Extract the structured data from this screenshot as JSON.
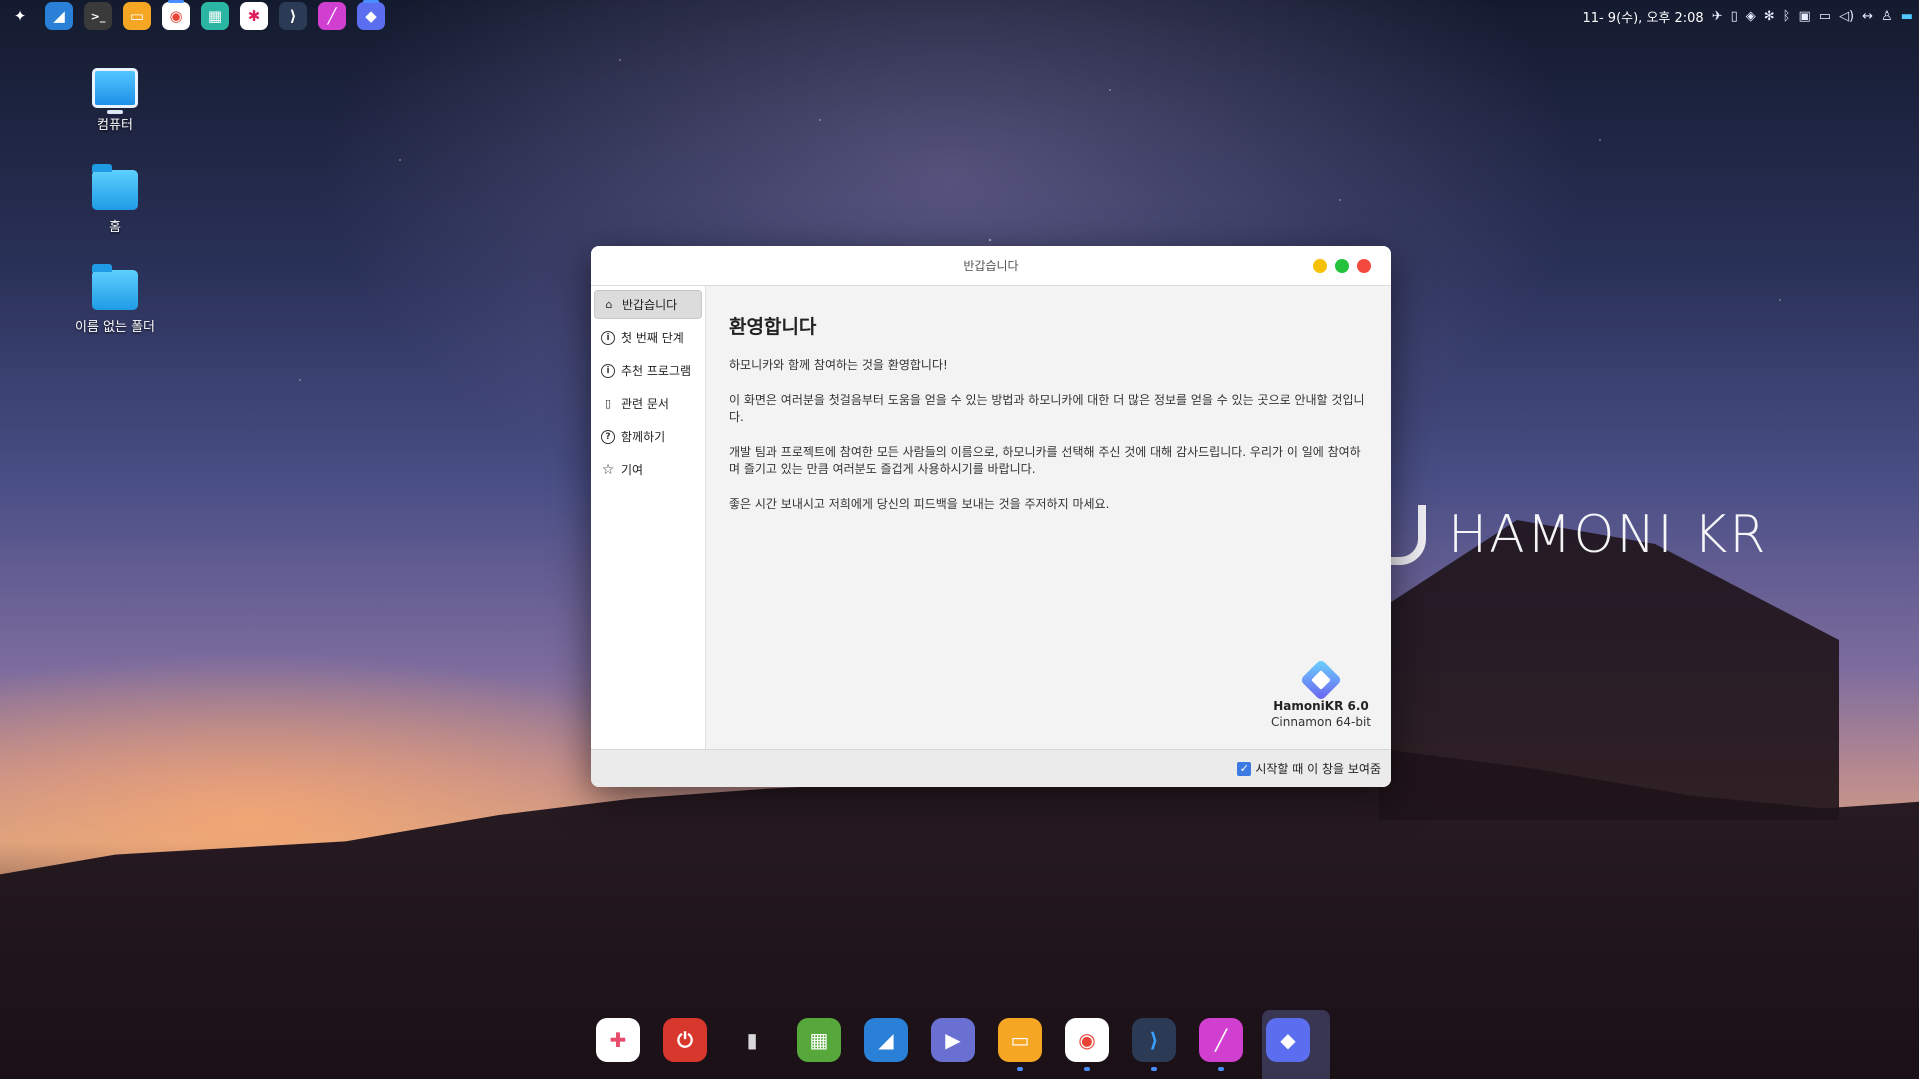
{
  "top_panel": {
    "apps": [
      {
        "icon": "hamonikr-menu-icon",
        "glyph": "✦",
        "color": "#4a6fd8"
      },
      {
        "icon": "bird-app-icon",
        "glyph": "◢",
        "color": "#2a7fd6"
      },
      {
        "icon": "terminal-icon",
        "glyph": ">_",
        "color": "#3a3a3a"
      },
      {
        "icon": "files-icon",
        "glyph": "▭",
        "color": "#f5a623"
      },
      {
        "icon": "chrome-icon",
        "glyph": "◉",
        "color": "#ea4335"
      },
      {
        "icon": "calculator-icon",
        "glyph": "▦",
        "color": "#2bb6a3"
      },
      {
        "icon": "slack-icon",
        "glyph": "✱",
        "color": "#ffffff"
      },
      {
        "icon": "vscode-icon",
        "glyph": "⟩",
        "color": "#2b6cb0"
      },
      {
        "icon": "pen-app-icon",
        "glyph": "╱",
        "color": "#d03fd0"
      },
      {
        "icon": "hamonikr-app-icon",
        "glyph": "◆",
        "color": "#5b6ef0"
      }
    ],
    "datetime": "11- 9(수), 오후 2:08"
  },
  "desktop": {
    "icons": [
      {
        "label": "컴퓨터"
      },
      {
        "label": "홈"
      },
      {
        "label": "이름 없는 폴더"
      }
    ]
  },
  "brand": {
    "text": "HAMONI KR"
  },
  "window": {
    "title": "반갑습니다",
    "sidebar": [
      {
        "label": "반갑습니다",
        "icon": "home-icon",
        "glyph": "⌂"
      },
      {
        "label": "첫 번째 단계",
        "icon": "info-icon",
        "glyph": "i"
      },
      {
        "label": "추천 프로그램",
        "icon": "info-icon",
        "glyph": "i"
      },
      {
        "label": "관련 문서",
        "icon": "book-icon",
        "glyph": "▯"
      },
      {
        "label": "함께하기",
        "icon": "help-icon",
        "glyph": "?"
      },
      {
        "label": "기여",
        "icon": "star-icon",
        "glyph": "☆"
      }
    ],
    "heading": "환영합니다",
    "paragraphs": [
      "하모니카와 함께 참여하는 것을 환영합니다!",
      "이 화면은 여러분을 첫걸음부터 도움을 얻을 수 있는 방법과 하모니카에 대한 더 많은 정보를 얻을 수 있는 곳으로 안내할 것입니다.",
      "개발 팀과 프로젝트에 참여한 모든 사람들의 이름으로, 하모니카를 선택해 주신 것에 대해 감사드립니다. 우리가 이 일에 참여하며 즐기고 있는 만큼 여러분도 즐겁게 사용하시기를 바랍니다.",
      "좋은 시간 보내시고 저희에게 당신의 피드백을 보내는 것을 주저하지 마세요."
    ],
    "version": "HamoniKR 6.0",
    "edition": "Cinnamon 64-bit",
    "show_on_startup": "시작할 때 이 창을 보여줌"
  },
  "dock": [
    {
      "icon": "media-app-icon",
      "glyph": "✚",
      "color": "#e64b6a"
    },
    {
      "icon": "power-icon",
      "glyph": "⏻",
      "color": "#d8372e"
    },
    {
      "icon": "trash-icon",
      "glyph": "▮",
      "color": "#d8d8d8"
    },
    {
      "icon": "software-center-icon",
      "glyph": "▦",
      "color": "#57a83a"
    },
    {
      "icon": "bird-app-icon",
      "glyph": "◢",
      "color": "#2a7fd6"
    },
    {
      "icon": "video-player-icon",
      "glyph": "▶",
      "color": "#6a6fd2"
    },
    {
      "icon": "files-icon",
      "glyph": "▭",
      "color": "#f5a623"
    },
    {
      "icon": "chrome-icon",
      "glyph": "◉",
      "color": "#ffffff"
    },
    {
      "icon": "vscode-icon",
      "glyph": "⟩",
      "color": "#2b3b55"
    },
    {
      "icon": "pen-app-icon",
      "glyph": "╱",
      "color": "#d03fd0"
    },
    {
      "icon": "hamonikr-app-icon",
      "glyph": "◆",
      "color": "#5b6ef0"
    }
  ]
}
